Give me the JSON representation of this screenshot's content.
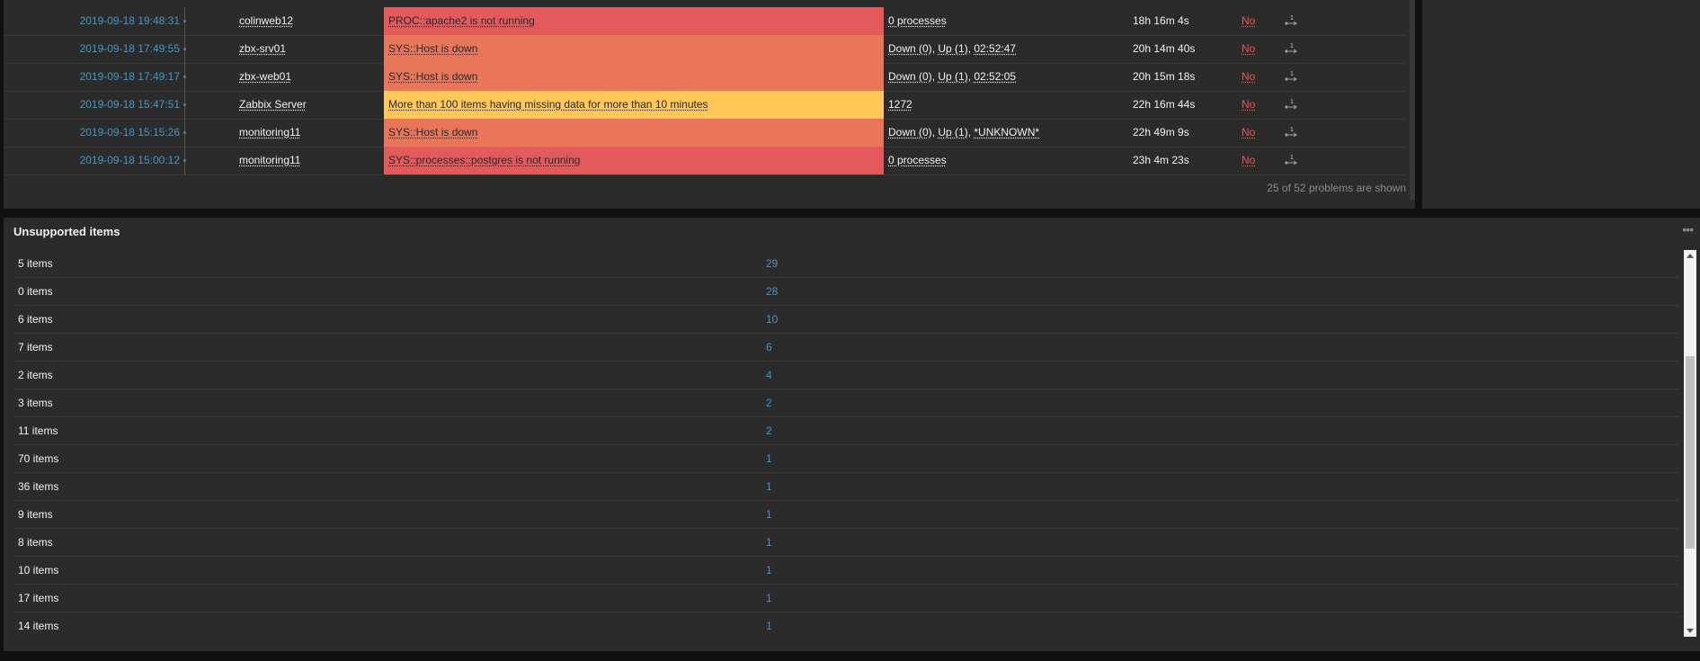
{
  "problems": {
    "rows": [
      {
        "time": "2019-09-18 19:48:31",
        "host": "colinweb12",
        "problem": "PROC::apache2 is not running",
        "severity_color": "#e45959",
        "opdata": [
          {
            "t": "0 processes",
            "u": true
          }
        ],
        "duration": "18h 16m 4s",
        "ack": "No"
      },
      {
        "time": "2019-09-18 17:49:55",
        "host": "zbx-srv01",
        "problem": "SYS::Host is down",
        "severity_color": "#e97659",
        "opdata": [
          {
            "t": "Down (0)",
            "u": true
          },
          {
            "t": ", ",
            "u": false
          },
          {
            "t": "Up (1)",
            "u": true
          },
          {
            "t": ", ",
            "u": false
          },
          {
            "t": "02:52:47",
            "u": true
          }
        ],
        "duration": "20h 14m 40s",
        "ack": "No"
      },
      {
        "time": "2019-09-18 17:49:17",
        "host": "zbx-web01",
        "problem": "SYS::Host is down",
        "severity_color": "#e97659",
        "opdata": [
          {
            "t": "Down (0)",
            "u": true
          },
          {
            "t": ", ",
            "u": false
          },
          {
            "t": "Up (1)",
            "u": true
          },
          {
            "t": ", ",
            "u": false
          },
          {
            "t": "02:52:05",
            "u": true
          }
        ],
        "duration": "20h 15m 18s",
        "ack": "No"
      },
      {
        "time": "2019-09-18 15:47:51",
        "host": "Zabbix Server",
        "problem": "More than 100 items having missing data for more than 10 minutes",
        "severity_color": "#ffc859",
        "opdata": [
          {
            "t": "1272",
            "u": true
          }
        ],
        "duration": "22h 16m 44s",
        "ack": "No"
      },
      {
        "time": "2019-09-18 15:15:26",
        "host": "monitoring11",
        "problem": "SYS::Host is down",
        "severity_color": "#e97659",
        "opdata": [
          {
            "t": "Down (0)",
            "u": true
          },
          {
            "t": ", ",
            "u": false
          },
          {
            "t": "Up (1)",
            "u": true
          },
          {
            "t": ", ",
            "u": false
          },
          {
            "t": "*UNKNOWN*",
            "u": true
          }
        ],
        "duration": "22h 49m 9s",
        "ack": "No"
      },
      {
        "time": "2019-09-18 15:00:12",
        "host": "monitoring11",
        "problem": "SYS::processes::postgres is not running",
        "severity_color": "#e45959",
        "opdata": [
          {
            "t": "0 processes",
            "u": true
          }
        ],
        "duration": "23h 4m 23s",
        "ack": "No"
      }
    ],
    "summary": "25 of 52 problems are shown",
    "action_icon": "action-arrow-icon",
    "action_count": "1"
  },
  "unsupported": {
    "title": "Unsupported items",
    "menu_icon": "more-dots-icon",
    "rows": [
      {
        "name": "5 items",
        "count": "29"
      },
      {
        "name": "0 items",
        "count": "28"
      },
      {
        "name": "6 items",
        "count": "10"
      },
      {
        "name": "7 items",
        "count": "6"
      },
      {
        "name": "2 items",
        "count": "4"
      },
      {
        "name": "3 items",
        "count": "2"
      },
      {
        "name": "11 items",
        "count": "2"
      },
      {
        "name": "70 items",
        "count": "1"
      },
      {
        "name": "36 items",
        "count": "1"
      },
      {
        "name": "9 items",
        "count": "1"
      },
      {
        "name": "8 items",
        "count": "1"
      },
      {
        "name": "10 items",
        "count": "1"
      },
      {
        "name": "17 items",
        "count": "1"
      },
      {
        "name": "14 items",
        "count": "1"
      }
    ]
  }
}
